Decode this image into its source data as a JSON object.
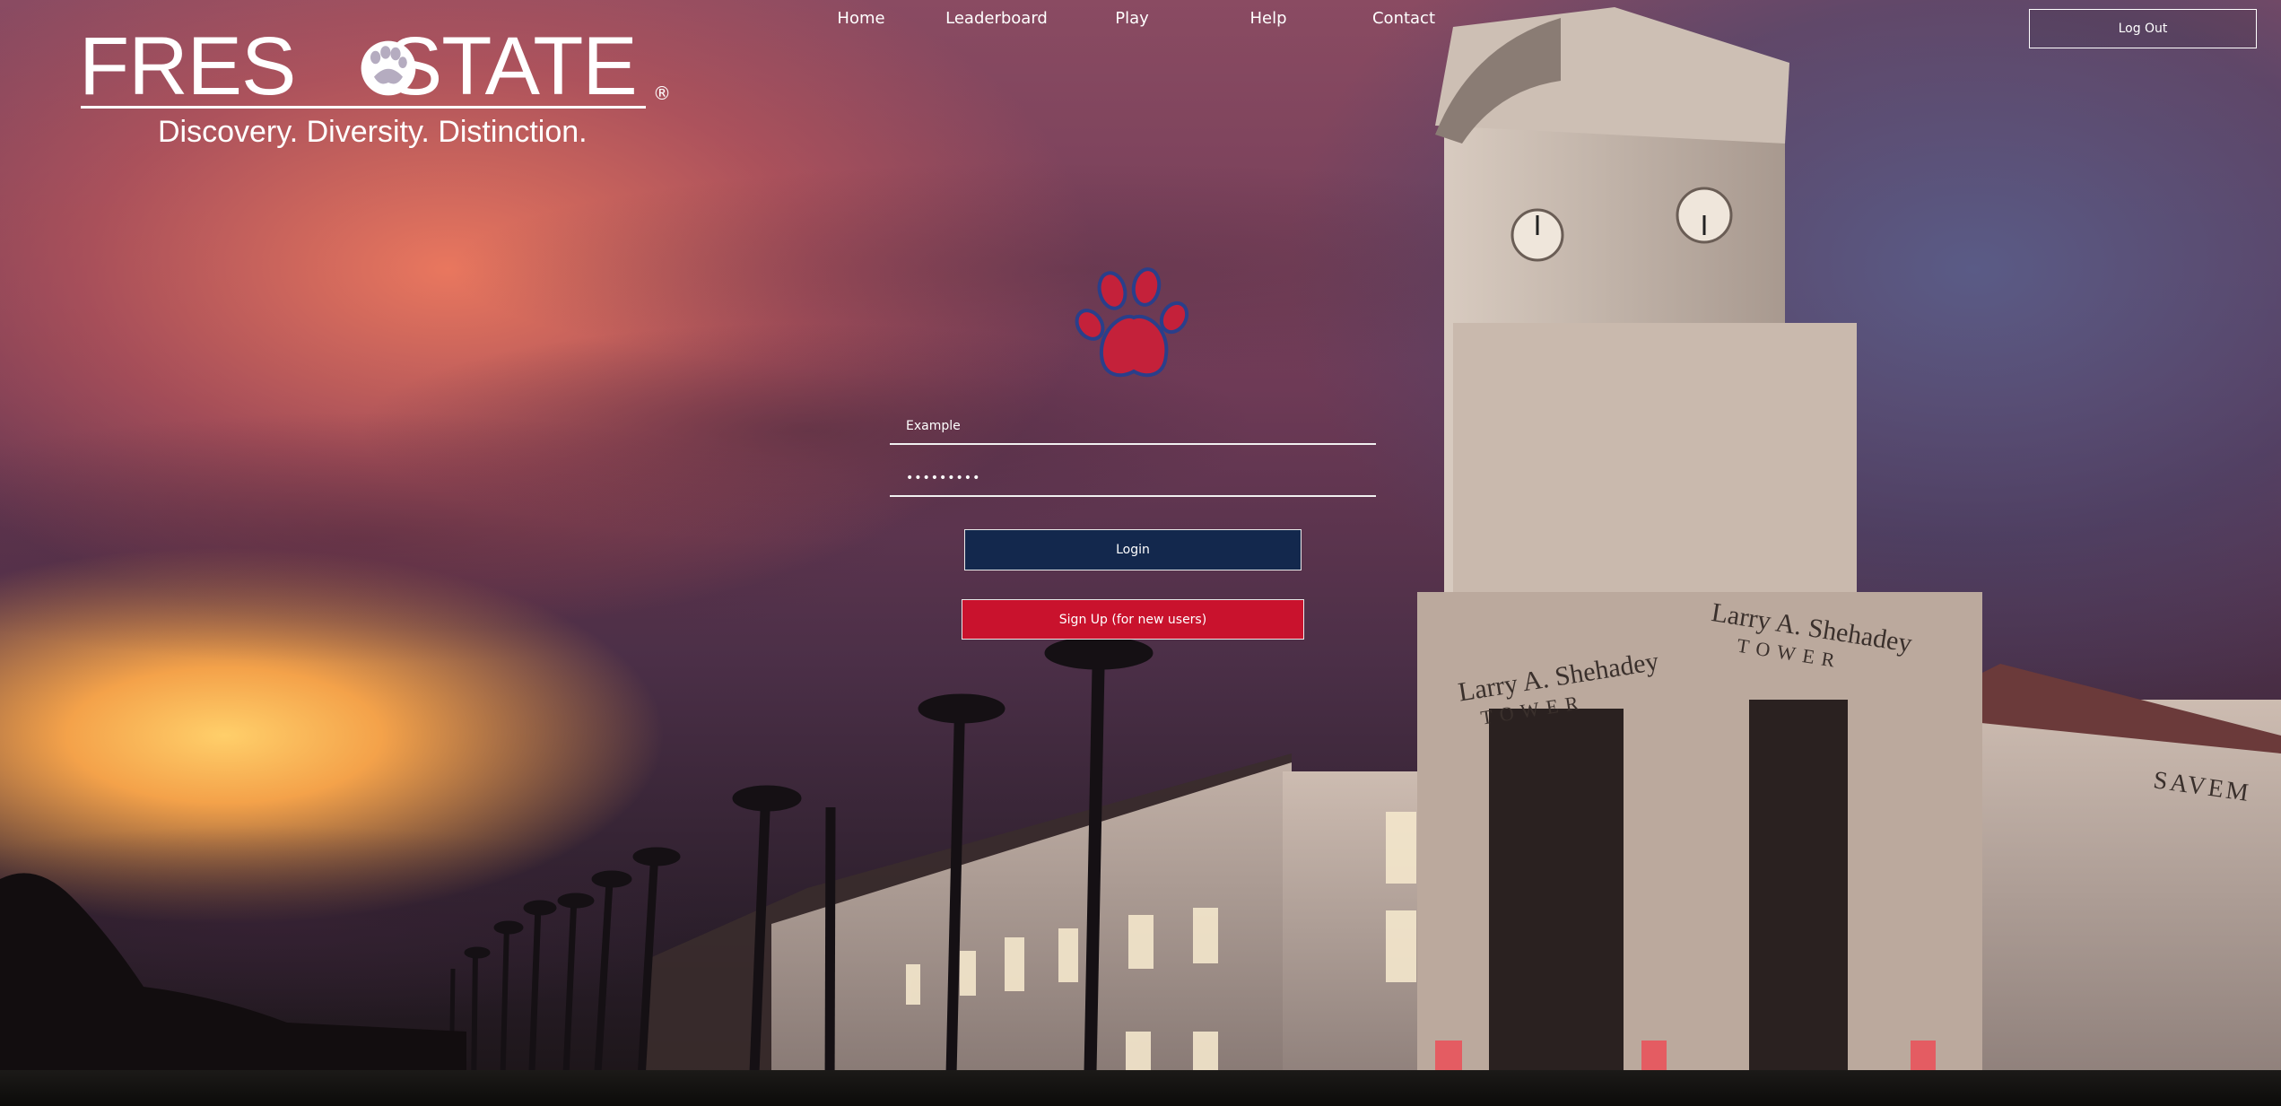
{
  "header": {
    "logo": {
      "wordmark": "FRESNO STATE",
      "registered": "®",
      "tagline": "Discovery. Diversity. Distinction."
    },
    "nav": [
      {
        "label": "Home"
      },
      {
        "label": "Leaderboard"
      },
      {
        "label": "Play"
      },
      {
        "label": "Help"
      },
      {
        "label": "Contact"
      }
    ],
    "logout_label": "Log Out"
  },
  "login_form": {
    "username": {
      "placeholder": "Example",
      "value": ""
    },
    "password": {
      "value": "•••••••••"
    },
    "login_label": "Login",
    "signup_label": "Sign Up (for new users)"
  },
  "background": {
    "tower_inscription_1": "Larry A. Shehadey",
    "tower_inscription_2": "TOWER",
    "building_inscription": "SAVEM"
  },
  "colors": {
    "login_button": "#13284d",
    "signup_button": "#c9122d",
    "paw_fill": "#c4213a",
    "paw_outline": "#2a3f8a"
  },
  "icons": {
    "center_logo": "bulldog-paw-icon",
    "logo_mark": "paw-icon"
  }
}
